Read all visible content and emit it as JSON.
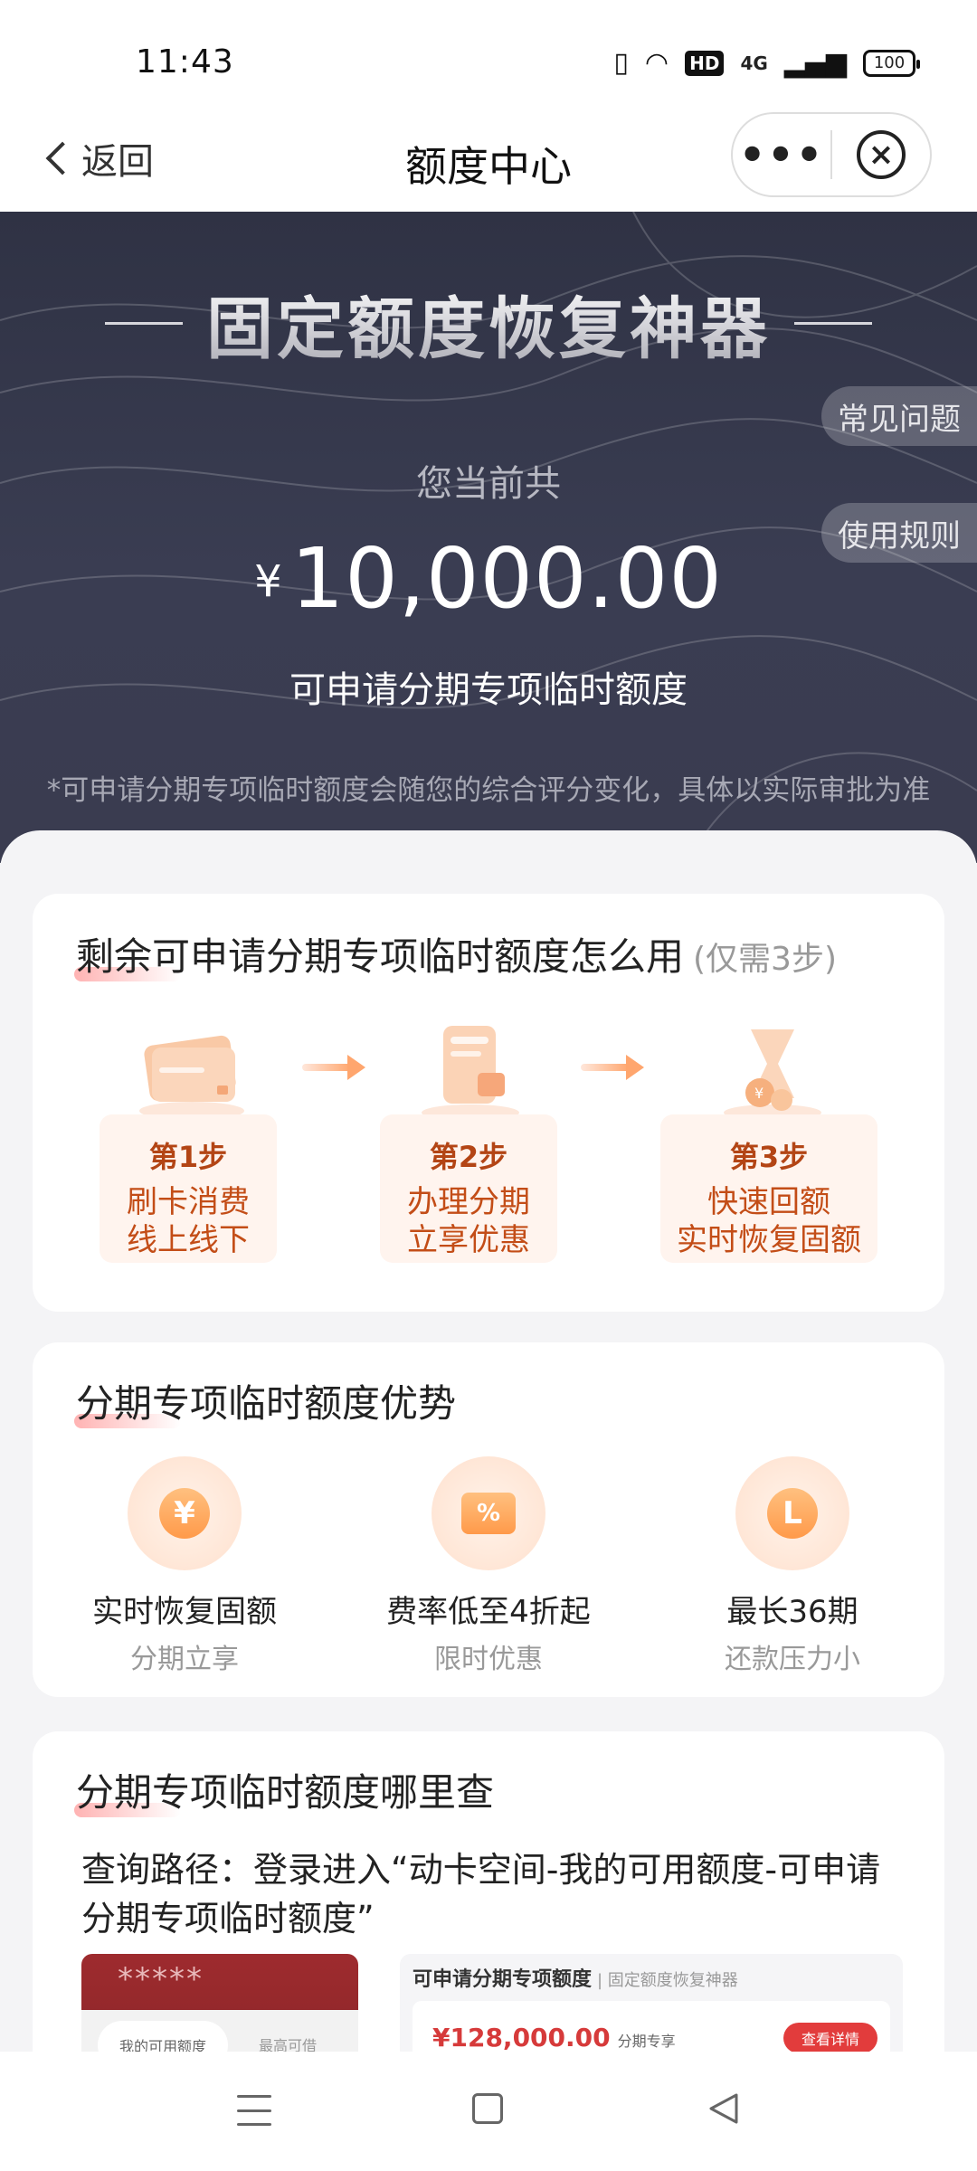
{
  "status_bar": {
    "time": "11:43",
    "hd": "HD",
    "network": "4G",
    "battery": "100"
  },
  "nav": {
    "back_label": "返回",
    "title": "额度中心",
    "more": "•••",
    "close": "×"
  },
  "hero": {
    "title": "固定额度恢复神器",
    "faq_tab": "常见问题",
    "rules_tab": "使用规则",
    "subtitle": "您当前共",
    "currency": "¥",
    "amount": "10,000.00",
    "amount_label": "可申请分期专项临时额度",
    "note": "*可申请分期专项临时额度会随您的综合评分变化，具体以实际审批为准"
  },
  "how_to_use": {
    "title": "剩余可申请分期专项临时额度怎么用",
    "title_note": "(仅需3步)",
    "steps": [
      {
        "title": "第1步",
        "line1": "刷卡消费",
        "line2": "线上线下",
        "icon": "credit-card-icon"
      },
      {
        "title": "第2步",
        "line1": "办理分期",
        "line2": "立享优惠",
        "icon": "phone-installment-icon"
      },
      {
        "title": "第3步",
        "line1": "快速回额",
        "line2": "实时恢复固额",
        "icon": "coin-hourglass-icon"
      }
    ]
  },
  "advantages": {
    "title": "分期专项临时额度优势",
    "items": [
      {
        "icon": "yen-icon",
        "glyph": "¥",
        "label": "实时恢复固额",
        "sub": "分期立享"
      },
      {
        "icon": "discount-ticket-icon",
        "glyph": "%",
        "label": "费率低至4折起",
        "sub": "限时优惠"
      },
      {
        "icon": "clock-icon",
        "glyph": "L",
        "label": "最长36期",
        "sub": "还款压力小"
      }
    ]
  },
  "where_to_check": {
    "title": "分期专项临时额度哪里查",
    "path": "查询路径：登录进入“动卡空间-我的可用额度-可申请分期专项临时额度”",
    "screenshot1": {
      "stars": "*****",
      "pill": "我的可用额度",
      "right": "最高可借"
    },
    "screenshot2": {
      "header": "可申请分期专项额度",
      "header_sub": "| 固定额度恢复神器",
      "amount": "¥128,000.00",
      "tag": "分期专享",
      "button": "查看详情"
    }
  },
  "colors": {
    "hero_bg": "#33364a",
    "accent_orange": "#c34d17",
    "highlight": "#ffb3b3",
    "button_red": "#e23c3c"
  }
}
